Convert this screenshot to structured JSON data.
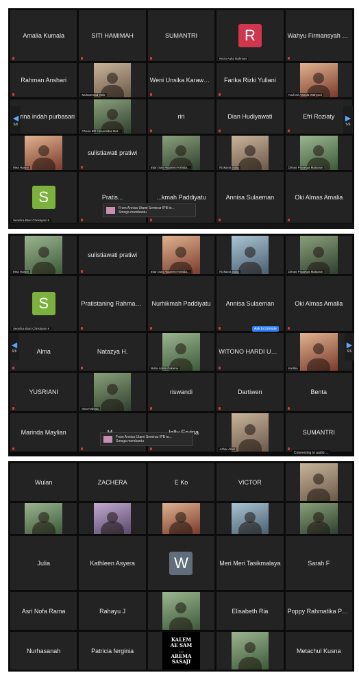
{
  "screens": [
    {
      "tiles": [
        {
          "name": "Amalia Kumala",
          "label": ""
        },
        {
          "name": "SITI HAMIMAH",
          "label": ""
        },
        {
          "name": "SUMANTRI",
          "label": ""
        },
        {
          "avatar": "R",
          "label": "Reza Aulia Rahman",
          "color": "#d1364f"
        },
        {
          "name": "Wahyu Firmansyah Ma'...",
          "label": ""
        },
        {
          "name": "Rahman Anshari",
          "label": ""
        },
        {
          "photo": true,
          "label": "Muhammad Yahr"
        },
        {
          "name": "Weni Unsika Karawang",
          "label": ""
        },
        {
          "name": "Farika Rizki Yuliani",
          "label": ""
        },
        {
          "photo": true,
          "label": "Andi Sri Astrida Wahyuni"
        },
        {
          "name": "Karina indah purbasari",
          "label": ""
        },
        {
          "photo": true,
          "label": "Cheria BG Universitas Bat..."
        },
        {
          "name": "riri",
          "label": ""
        },
        {
          "name": "Dian Hudiyawati",
          "label": ""
        },
        {
          "name": "Efri Roziaty",
          "label": ""
        },
        {
          "photo": true,
          "label": "Mea Hasrin"
        },
        {
          "name": "sulistiawati pratiwi",
          "label": ""
        },
        {
          "photo": true,
          "label": "Intan Sari Akademi Kebida..."
        },
        {
          "photo": true,
          "label": "Rizkiana Sidig"
        },
        {
          "photo": true,
          "label": "Dimas Prasetya Mataram"
        },
        {
          "avatar": "S",
          "label": "Serafica Btari Christiyani K",
          "color": "#7bb13c"
        },
        {
          "name": "Pratis...",
          "label": ""
        },
        {
          "name": "...kmah Paddiyatu",
          "label": ""
        },
        {
          "name": "Annisa Sulaeman",
          "label": ""
        },
        {
          "name": "Oki Almas Amalia",
          "label": ""
        }
      ],
      "page_left": "5/6",
      "page_right": "5/6",
      "toast": {
        "from": "From Annisa Utami Seminar IPB to...",
        "msg": "Smoga membantu"
      }
    },
    {
      "tiles": [
        {
          "photo": true,
          "label": "Mea Hasrin"
        },
        {
          "name": "sulistiawati pratiwi",
          "label": ""
        },
        {
          "photo": true,
          "label": "Intan Sari Akademi Kebida..."
        },
        {
          "photo": true,
          "label": "Rizkiana Sidig"
        },
        {
          "photo": true,
          "label": "Dimas Prasetya Mataram"
        },
        {
          "avatar": "S",
          "label": "Serafica Btari Christiyani K",
          "color": "#7bb13c"
        },
        {
          "name": "Pratistaning Rahmawati",
          "label": ""
        },
        {
          "name": "Nurhikmah Paddiyatu",
          "label": ""
        },
        {
          "name": "Annisa Sulaeman",
          "label": ""
        },
        {
          "name": "Oki Almas Amalia",
          "label": ""
        },
        {
          "name": "Alma",
          "label": ""
        },
        {
          "name": "Natazya H.",
          "label": ""
        },
        {
          "photo": true,
          "label": "Nuha Adela Fakiena"
        },
        {
          "name": "WITONO HARDI UNIVE...",
          "label": ""
        },
        {
          "photo": true,
          "label": "Kartika"
        },
        {
          "name": "YUSRIANI",
          "label": ""
        },
        {
          "photo": true,
          "label": "Isna Rahma"
        },
        {
          "name": "riswandi",
          "label": ""
        },
        {
          "name": "Dartiwen",
          "label": ""
        },
        {
          "name": "Benta",
          "label": ""
        },
        {
          "name": "Marinda Maylian",
          "label": ""
        },
        {
          "name": "M...",
          "label": ""
        },
        {
          "name": "...lelly Ervina",
          "label": ""
        },
        {
          "photo": true,
          "label": "Azhar Alam"
        },
        {
          "name": "SUMANTRI",
          "label": ""
        }
      ],
      "page_left": "6/6",
      "page_right": "6/6",
      "ask_unmute": "Ask to Unmute",
      "connecting": "Connecting to audio ...",
      "toast": {
        "from": "From Annisa Utami Seminar IPB to...",
        "msg": "Smoga membantu"
      }
    },
    {
      "tiles": [
        {
          "name": "Wulan",
          "label": ""
        },
        {
          "name": "ZACHERA",
          "label": ""
        },
        {
          "name": "E Ko",
          "label": ""
        },
        {
          "name": "VICTOR",
          "label": ""
        },
        {
          "photo": true,
          "label": ""
        },
        {
          "photo": true,
          "label": ""
        },
        {
          "photo": true,
          "label": ""
        },
        {
          "photo": true,
          "label": ""
        },
        {
          "photo": true,
          "label": ""
        },
        {
          "photo": true,
          "label": ""
        },
        {
          "name": "Julia",
          "label": ""
        },
        {
          "name": "Kathleen Asyera",
          "label": ""
        },
        {
          "avatar": "W",
          "label": "",
          "color": "#5f6e7a"
        },
        {
          "name": "Meri Meri Tasikmalaya",
          "label": ""
        },
        {
          "name": "Sarah F",
          "label": ""
        },
        {
          "name": "Asri Nofa Rama",
          "label": ""
        },
        {
          "name": "Rahayu J",
          "label": ""
        },
        {
          "photo": true,
          "label": ""
        },
        {
          "name": "Elisabeth Ria",
          "label": ""
        },
        {
          "name": "Poppy Rahmatika Prima...",
          "label": ""
        },
        {
          "name": "Nurhasanah",
          "label": ""
        },
        {
          "name": "Patricia ferginia",
          "label": ""
        },
        {
          "logo": [
            "KALEM",
            "AE SAM",
            "...",
            "AREMA",
            "SASAJI"
          ],
          "label": ""
        },
        {
          "photo": true,
          "label": ""
        },
        {
          "name": "Metachul Kusna",
          "label": ""
        }
      ]
    }
  ]
}
